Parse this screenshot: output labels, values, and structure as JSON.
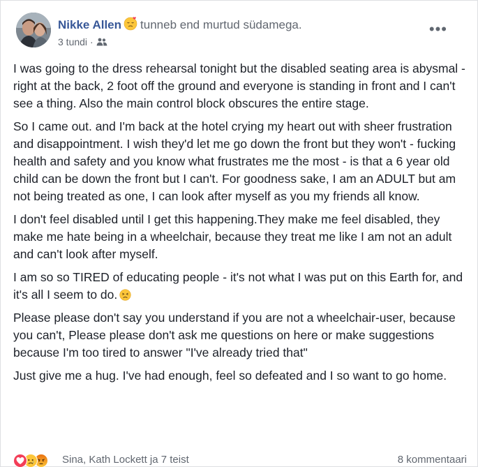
{
  "post": {
    "author": "Nikke Allen",
    "feeling": "tunneb end murtud südamega.",
    "feeling_emoji": "broken-hearted-face-icon",
    "timestamp": "3 tundi",
    "dot": "·",
    "audience_icon": "friends-icon",
    "more_label": "•••",
    "paragraphs": [
      "I was going to the dress rehearsal tonight but the disabled seating area is abysmal - right at the back, 2 foot off the ground and everyone is standing in front and I can't see a thing. Also the main control block obscures the entire stage.",
      "So I came out. and I'm back at the hotel crying my heart out with sheer frustration and disappointment. I wish they'd let me go down the front but they won't - fucking health and safety and you know what frustrates me the most - is that a 6 year old child can be down the front but I can't. For goodness sake, I am an ADULT but am not being treated as one, I can look after myself as you my friends all know.",
      "I don't feel disabled until I get this happening.They make me feel disabled, they make me hate being in a wheelchair, because they treat me like I am not an adult and can't look after myself.",
      "I am so so TIRED of educating people - it's not what I was put on this Earth for, and it's all I seem to do.",
      "Please please don't say you understand if you are not a wheelchair-user, because you can't, Please please don't ask me questions on here or make suggestions because I'm too tired to answer \"I've already tried that\"",
      "Just give me a hug. I've had enough, feel so defeated and I so want to go home."
    ],
    "persevering_emoji": "persevering-face-icon"
  },
  "footer": {
    "reactions": [
      "love-reaction-icon",
      "sad-reaction-icon",
      "angry-reaction-icon"
    ],
    "reacted_by": "Sina, Kath Lockett ja 7 teist",
    "comments": "8 kommentaari"
  },
  "colors": {
    "author": "#385898",
    "secondary_text": "#616770",
    "body_text": "#1d2129",
    "love": "#f33e58",
    "reaction_yellow": "#fcc63a",
    "angry": "#e9710f"
  }
}
